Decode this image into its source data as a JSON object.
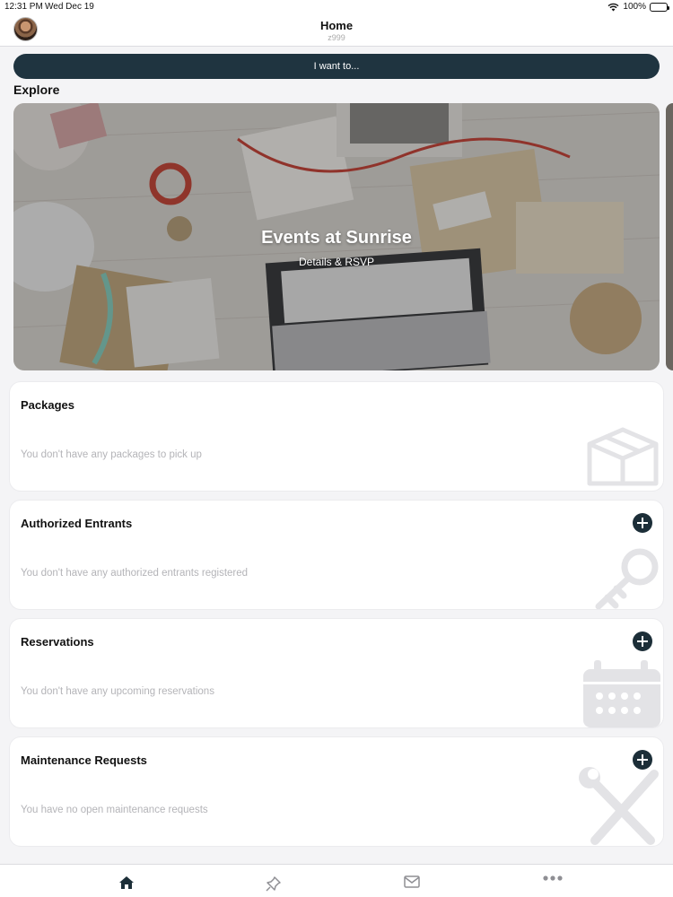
{
  "status_bar": {
    "time": "12:31 PM",
    "date": "Wed Dec 19",
    "battery": "100%"
  },
  "nav": {
    "title": "Home",
    "subtitle": "z999"
  },
  "want_button": "I want to...",
  "explore": {
    "title": "Explore",
    "hero": {
      "title": "Events at Sunrise",
      "subtitle": "Details & RSVP"
    }
  },
  "cards": {
    "packages": {
      "title": "Packages",
      "empty": "You don't have any packages to pick up",
      "art_icon": "package-box-icon"
    },
    "entrants": {
      "title": "Authorized Entrants",
      "empty": "You don't have any authorized entrants registered",
      "art_icon": "key-icon"
    },
    "reservations": {
      "title": "Reservations",
      "empty": "You don't have any upcoming reservations",
      "art_icon": "calendar-icon"
    },
    "maintenance": {
      "title": "Maintenance Requests",
      "empty": "You have no open maintenance requests",
      "art_icon": "tools-icon"
    }
  },
  "tab_bar": {
    "active": "home",
    "tabs": [
      "home-icon",
      "pin-icon",
      "mail-icon",
      "more-icon"
    ]
  },
  "colors": {
    "accent": "#1f3440",
    "background": "#f4f4f6",
    "muted_text": "#b4b4b8"
  }
}
